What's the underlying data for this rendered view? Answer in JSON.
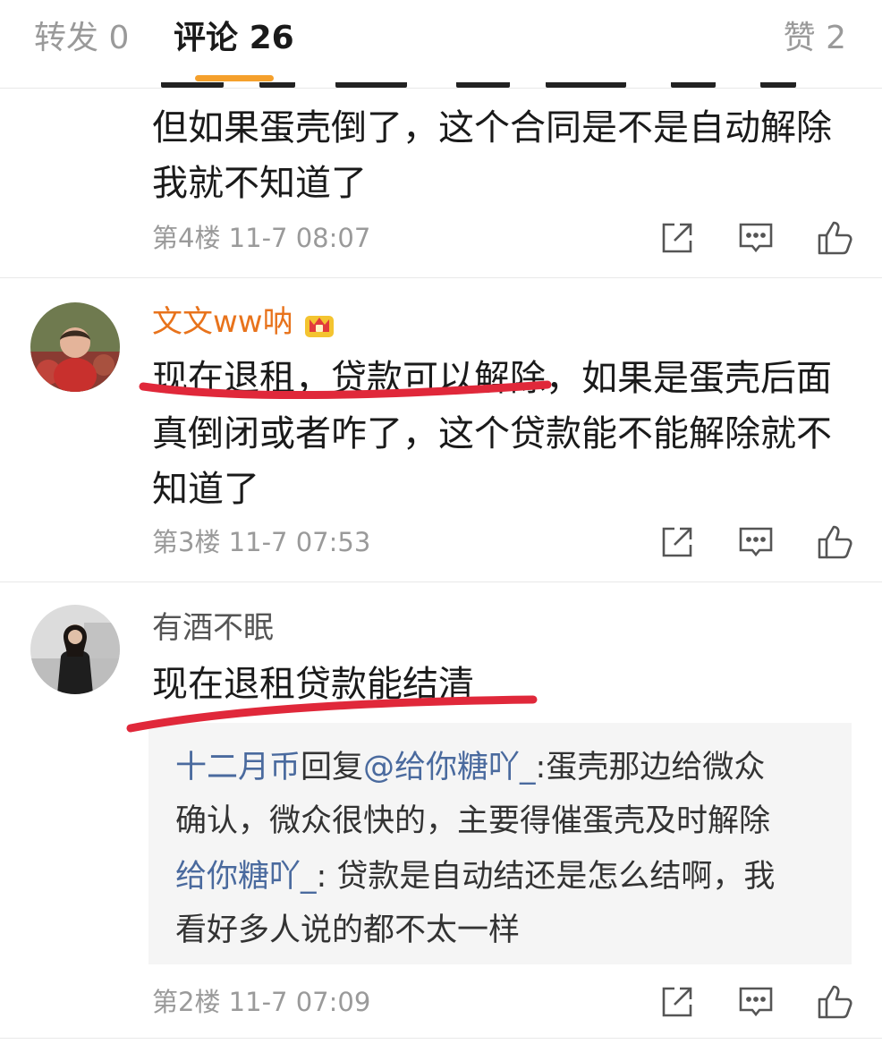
{
  "tabs": {
    "repost": {
      "label": "转发",
      "count": "0"
    },
    "comments": {
      "label": "评论",
      "count": "26"
    },
    "likes": {
      "label": "赞",
      "count": "2"
    }
  },
  "comments": [
    {
      "lines": [
        "但如果蛋壳倒了，这个合同是不是自动解除",
        "我就不知道了"
      ],
      "floor": "第4楼",
      "time": "11-7 08:07"
    },
    {
      "username": "文文ww呐",
      "badge_icon": "crown-vip-icon",
      "lines": [
        "现在退租，贷款可以解除，如果是蛋壳后面",
        "真倒闭或者咋了，这个贷款能不能解除就不",
        "知道了"
      ],
      "floor": "第3楼",
      "time": "11-7 07:53"
    },
    {
      "username": "有酒不眠",
      "lines": [
        "现在退租贷款能结清"
      ],
      "replies": [
        {
          "author": "十二月币",
          "verb": "回复",
          "mention": "@给你糖吖_",
          "text_first": ":蛋壳那边给微众",
          "text_rest": "确认，微众很快的，主要得催蛋壳及时解除"
        },
        {
          "author": "给你糖吖_",
          "text_first": ": 贷款是自动结还是怎么结啊，我",
          "text_rest": "看好多人说的都不太一样"
        }
      ],
      "floor": "第2楼",
      "time": "11-7 07:09"
    }
  ],
  "icons": {
    "share": "share-icon",
    "reply": "comment-icon",
    "like": "thumbs-up-icon"
  },
  "colors": {
    "accent": "#f5a02c",
    "username_vip": "#e8731c",
    "link": "#4a6a9e",
    "annotation": "#e0283a",
    "meta": "#9a9a9a"
  }
}
